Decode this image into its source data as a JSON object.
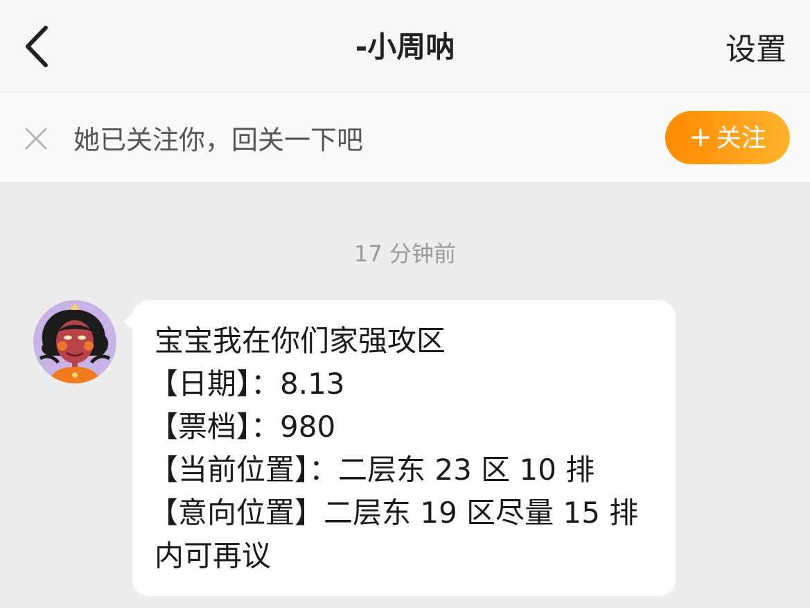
{
  "header": {
    "title": "-小周呐",
    "settings_label": "设置"
  },
  "banner": {
    "text": "她已关注你，回关一下吧",
    "follow_button_label": "关注",
    "follow_button_icon": "plus-icon",
    "accent_color": "#ff8a00"
  },
  "chat": {
    "timestamp": "17 分钟前",
    "message": {
      "lines": [
        "宝宝我在你们家强攻区",
        "【日期】：8.13",
        "【票档】：980",
        "【当前位置】：二层东 23 区 10 排",
        "【意向位置】二层东 19 区尽量 15 排",
        "内可再议"
      ]
    }
  }
}
